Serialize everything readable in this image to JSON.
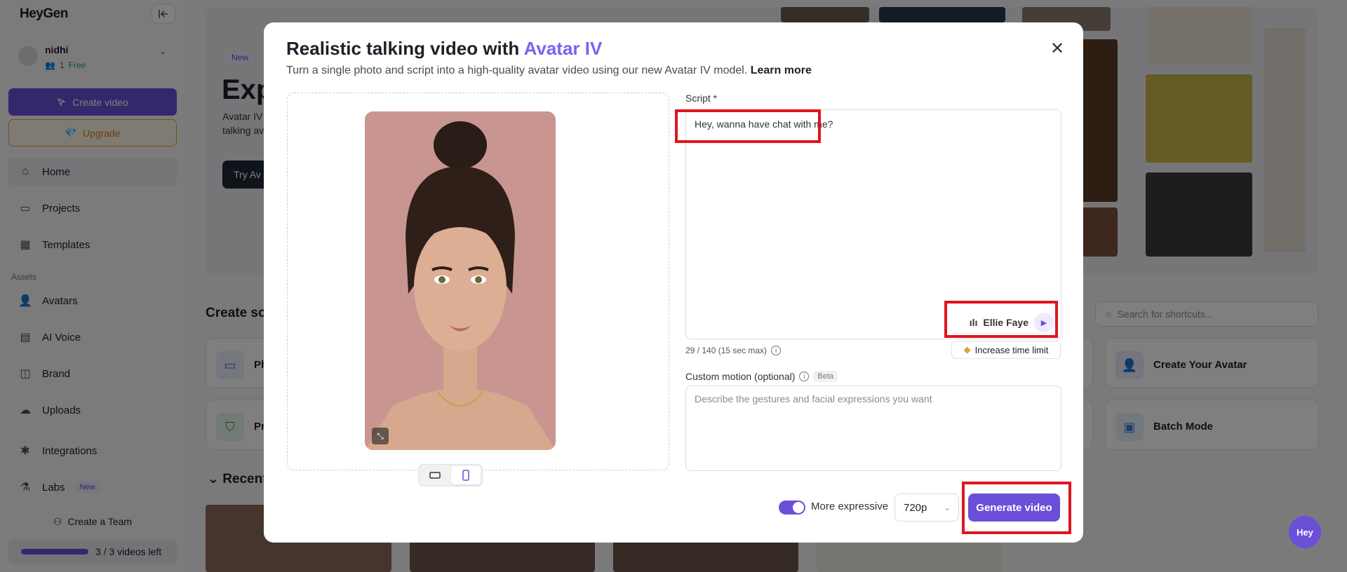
{
  "sidebar": {
    "logo": "HeyGen",
    "user": {
      "name": "nidhi",
      "members": "1",
      "plan": "Free"
    },
    "create_label": "Create video",
    "upgrade_label": "Upgrade",
    "nav": [
      {
        "label": "Home",
        "icon": "home-icon"
      },
      {
        "label": "Projects",
        "icon": "folder-icon"
      },
      {
        "label": "Templates",
        "icon": "templates-icon"
      }
    ],
    "assets_heading": "Assets",
    "assets": [
      {
        "label": "Avatars",
        "icon": "avatar-icon"
      },
      {
        "label": "AI Voice",
        "icon": "voice-icon"
      },
      {
        "label": "Brand",
        "icon": "brand-icon"
      },
      {
        "label": "Uploads",
        "icon": "upload-icon"
      },
      {
        "label": "Integrations",
        "icon": "integrations-icon"
      },
      {
        "label": "Labs",
        "icon": "labs-icon",
        "badge": "New"
      }
    ],
    "create_team_label": "Create a Team",
    "videos_left": "3 / 3 videos left",
    "videos_fraction": 1.0
  },
  "background": {
    "hero": {
      "badge": "New",
      "title": "Exp",
      "desc": "Avatar IV talking av",
      "button": "Try Av"
    },
    "create_section_title": "Create so",
    "cards": [
      "Ph",
      "Pr",
      "Create Your Avatar",
      "Batch Mode"
    ],
    "search_placeholder": "Search for shortcuts...",
    "recent_title": "Recent"
  },
  "modal": {
    "title_prefix": "Realistic talking video with ",
    "title_accent": "Avatar IV",
    "subtitle": "Turn a single photo and script into a high-quality avatar video using our new Avatar IV model. ",
    "learn_more": "Learn more",
    "script_label": "Script *",
    "script_text": "Hey, wanna have chat with me?",
    "voice_name": "Ellie Faye",
    "char_count": "29 / 140 (15 sec max)",
    "increase_label": "Increase time limit",
    "motion_label": "Custom motion (optional)",
    "motion_badge": "Beta",
    "motion_placeholder": "Describe the gestures and facial expressions you want",
    "expressive_label": "More expressive",
    "expressive_on": true,
    "quality": "720p",
    "generate_label": "Generate video"
  },
  "help_bubble": "Hey",
  "colors": {
    "accent": "#6b4fd8",
    "highlight": "#e0141e"
  }
}
